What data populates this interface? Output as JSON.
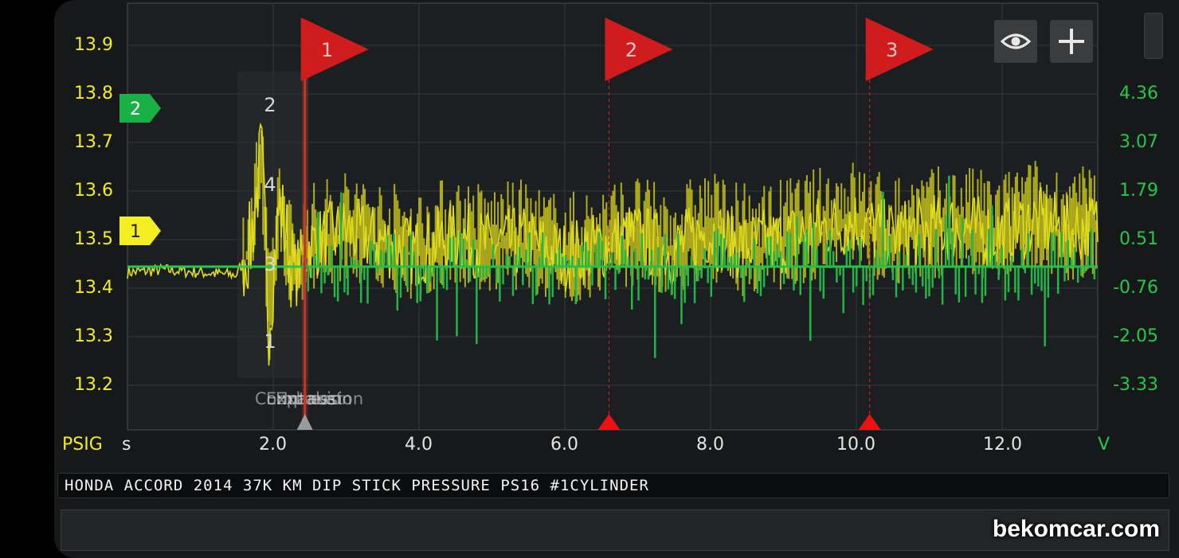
{
  "left_axis": {
    "unit": "PSIG",
    "ticks": [
      "13.9",
      "13.8",
      "13.7",
      "13.6",
      "13.5",
      "13.4",
      "13.3",
      "13.2"
    ],
    "range": [
      13.15,
      13.98
    ],
    "color": "#f2ee22"
  },
  "right_axis": {
    "unit": "V",
    "ticks": [
      "4.36",
      "3.07",
      "1.79",
      "0.51",
      "-0.76",
      "-2.05",
      "-3.33"
    ],
    "color": "#27c64a"
  },
  "x_axis": {
    "unit": "s",
    "ticks": [
      "2.0",
      "4.0",
      "6.0",
      "8.0",
      "10.0",
      "12.0"
    ],
    "range": [
      0.0,
      13.4
    ]
  },
  "channel_markers": [
    {
      "label": "1",
      "color": "#f2ee22"
    },
    {
      "label": "2",
      "color": "#19b046"
    }
  ],
  "cursors": [
    {
      "label": "1",
      "time_s": 2.45
    },
    {
      "label": "2",
      "time_s": 6.65
    },
    {
      "label": "3",
      "time_s": 10.25
    }
  ],
  "stroke_labels": {
    "numbers": [
      "2",
      "4",
      "3",
      "1"
    ],
    "words": [
      "Compression",
      "Exhaust",
      "Expansion",
      "Intake"
    ]
  },
  "toolbar": {
    "eye_icon": "eye-icon",
    "plus_icon": "plus-icon"
  },
  "title": "HONDA ACCORD 2014 37K KM DIP STICK PRESSURE PS16 #1CYLINDER",
  "watermark": "bekomcar.com",
  "chart_data": {
    "type": "line",
    "x_range": [
      0.0,
      13.4
    ],
    "series": [
      {
        "axis": "left",
        "color": "#f2ee22",
        "x": [
          0.0,
          0.5,
          1.0,
          1.5,
          1.7,
          1.85,
          1.95,
          2.1,
          2.3,
          2.5,
          3.0,
          3.5,
          4.0,
          4.5,
          5.0,
          5.5,
          6.0,
          6.5,
          7.0,
          7.5,
          8.0,
          8.5,
          9.0,
          9.5,
          10.0,
          10.5,
          11.0,
          11.5,
          12.0,
          12.5,
          13.0,
          13.4
        ],
        "values": [
          13.455,
          13.46,
          13.455,
          13.45,
          13.5,
          13.68,
          13.35,
          13.58,
          13.44,
          13.5,
          13.53,
          13.51,
          13.49,
          13.52,
          13.5,
          13.51,
          13.48,
          13.5,
          13.52,
          13.49,
          13.53,
          13.5,
          13.51,
          13.53,
          13.55,
          13.52,
          13.53,
          13.54,
          13.52,
          13.55,
          13.53,
          13.54
        ]
      },
      {
        "axis": "right",
        "color": "#27c64a",
        "x": [
          0.0,
          2.45,
          3.0,
          4.0,
          5.0,
          6.0,
          7.0,
          8.0,
          9.0,
          10.0,
          11.0,
          12.0,
          13.0,
          13.4
        ],
        "values": [
          0.0,
          0.0,
          0.2,
          -0.3,
          0.4,
          -0.2,
          0.3,
          -0.4,
          0.1,
          0.3,
          -0.3,
          0.2,
          0.4,
          0.1
        ]
      }
    ]
  }
}
